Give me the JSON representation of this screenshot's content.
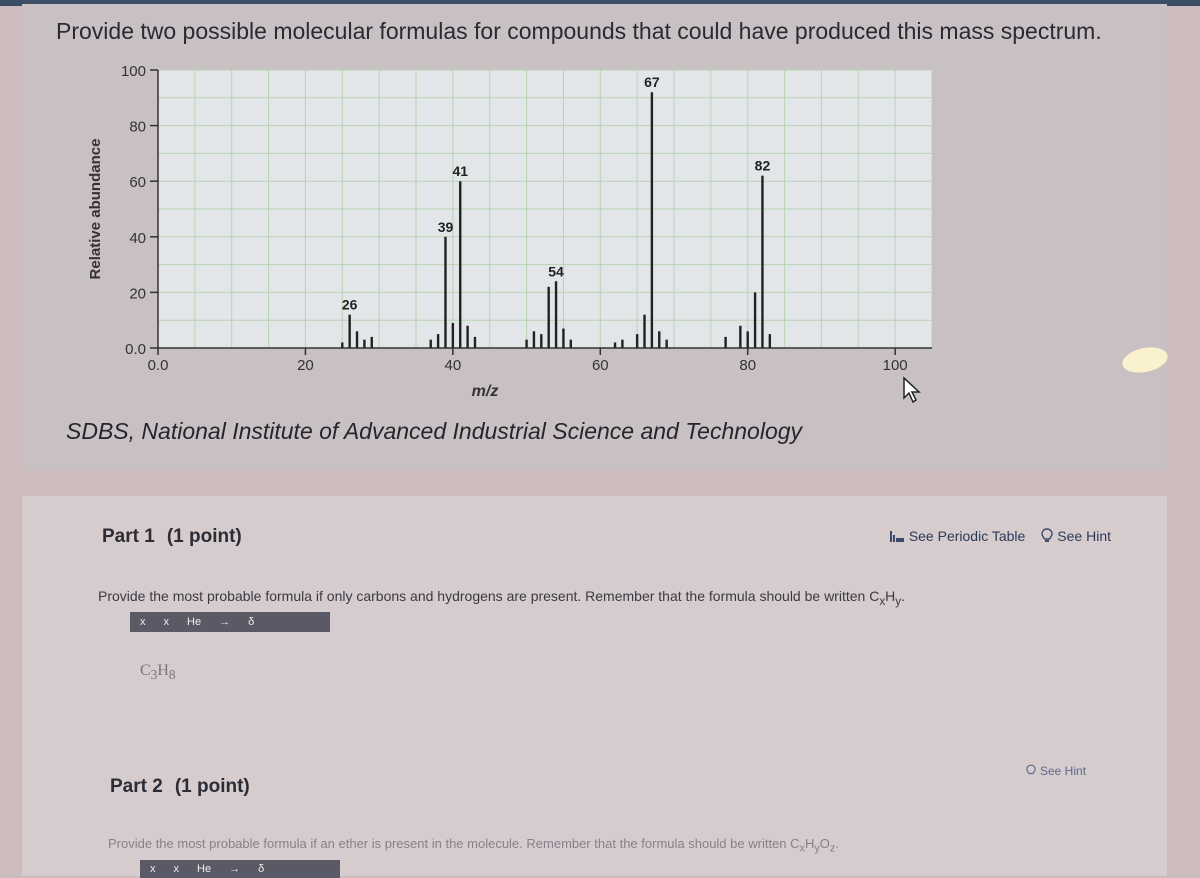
{
  "question": {
    "title": "Provide two possible molecular formulas for compounds that could have produced this mass spectrum.",
    "source": "SDBS, National Institute of Advanced Industrial Science and Technology"
  },
  "chart_data": {
    "type": "bar",
    "xlabel": "m/z",
    "ylabel": "Relative abundance",
    "xlim": [
      0,
      105
    ],
    "ylim": [
      0,
      100
    ],
    "x_ticks": [
      0,
      20,
      40,
      60,
      80,
      100
    ],
    "x_tick_labels": [
      "0.0",
      "20",
      "40",
      "60",
      "80",
      "100"
    ],
    "y_ticks": [
      0,
      20,
      40,
      60,
      80,
      100
    ],
    "y_tick_labels": [
      "0.0",
      "20",
      "40",
      "60",
      "80",
      "100"
    ],
    "grid": true,
    "peaks": [
      {
        "x": 25,
        "y": 2
      },
      {
        "x": 26,
        "y": 12,
        "label": "26"
      },
      {
        "x": 27,
        "y": 6
      },
      {
        "x": 28,
        "y": 3
      },
      {
        "x": 29,
        "y": 4
      },
      {
        "x": 37,
        "y": 3
      },
      {
        "x": 38,
        "y": 5
      },
      {
        "x": 39,
        "y": 40,
        "label": "39"
      },
      {
        "x": 40,
        "y": 9
      },
      {
        "x": 41,
        "y": 60,
        "label": "41"
      },
      {
        "x": 42,
        "y": 8
      },
      {
        "x": 43,
        "y": 4
      },
      {
        "x": 50,
        "y": 3
      },
      {
        "x": 51,
        "y": 6
      },
      {
        "x": 52,
        "y": 5
      },
      {
        "x": 53,
        "y": 22
      },
      {
        "x": 54,
        "y": 24,
        "label": "54"
      },
      {
        "x": 55,
        "y": 7
      },
      {
        "x": 56,
        "y": 3
      },
      {
        "x": 62,
        "y": 2
      },
      {
        "x": 63,
        "y": 3
      },
      {
        "x": 65,
        "y": 5
      },
      {
        "x": 66,
        "y": 12
      },
      {
        "x": 67,
        "y": 92,
        "label": "67"
      },
      {
        "x": 68,
        "y": 6
      },
      {
        "x": 69,
        "y": 3
      },
      {
        "x": 77,
        "y": 4
      },
      {
        "x": 79,
        "y": 8
      },
      {
        "x": 80,
        "y": 6
      },
      {
        "x": 81,
        "y": 20
      },
      {
        "x": 82,
        "y": 62,
        "label": "82"
      },
      {
        "x": 83,
        "y": 5
      }
    ]
  },
  "part1": {
    "title": "Part 1",
    "points": "(1 point)",
    "see_periodic_table": "See Periodic Table",
    "see_hint": "See Hint",
    "instruction": "Provide the most probable formula if only carbons and hydrogens are present. Remember that the formula should be written C",
    "instruction_sub": "x",
    "instruction_mid": "H",
    "instruction_sub2": "y",
    "instruction_end": ".",
    "toolbar": [
      "x",
      "x",
      "He",
      "→",
      "δ"
    ],
    "answer": "C",
    "answer_sub1": "3",
    "answer_mid": "H",
    "answer_sub2": "8"
  },
  "part2": {
    "title": "Part 2",
    "points": "(1 point)",
    "see_hint": "See Hint",
    "instruction": "Provide the most probable formula if an ether is present in the molecule. Remember that the formula should be written C",
    "instruction_sub": "x",
    "instruction_mid": "H",
    "instruction_sub2": "y",
    "instruction_mid2": "O",
    "instruction_sub3": "z",
    "instruction_end": ".",
    "toolbar": [
      "x",
      "x",
      "He",
      "→",
      "δ"
    ]
  }
}
